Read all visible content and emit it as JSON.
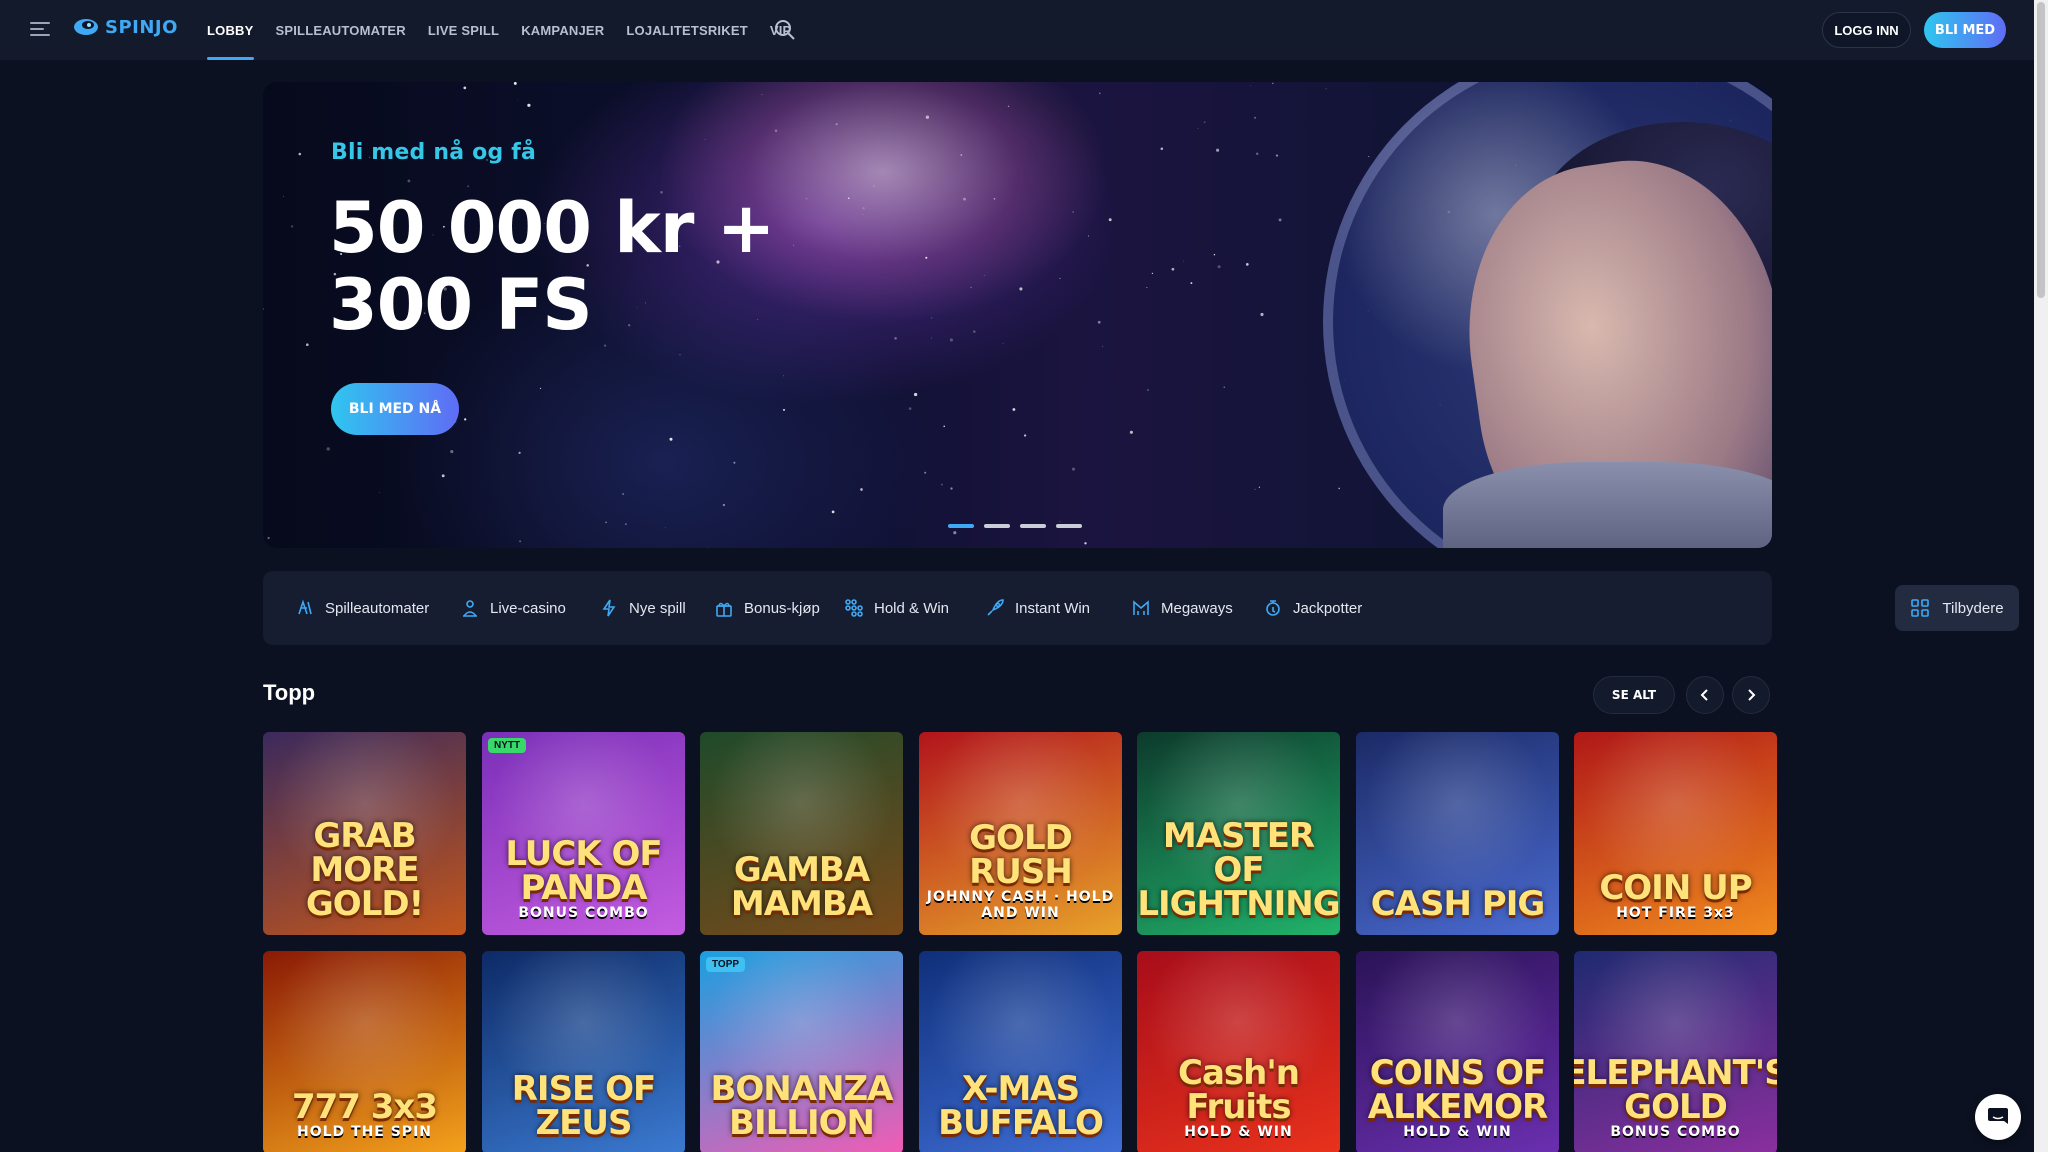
{
  "header": {
    "logo_text": "SPINJO",
    "nav": [
      {
        "label": "LOBBY",
        "active": true
      },
      {
        "label": "SPILLEAUTOMATER",
        "active": false
      },
      {
        "label": "LIVE SPILL",
        "active": false
      },
      {
        "label": "KAMPANJER",
        "active": false
      },
      {
        "label": "LOJALITETSRIKET",
        "active": false
      },
      {
        "label": "VIP",
        "active": false
      }
    ],
    "login_label": "LOGG INN",
    "join_label": "BLI MED"
  },
  "hero": {
    "eyebrow": "Bli med nå og få",
    "title_line1": "50 000 kr +",
    "title_line2": "300 FS",
    "cta_label": "BLI MED NÅ",
    "slides_total": 4,
    "active_slide": 1
  },
  "categories": [
    {
      "label": "Spilleautomater",
      "icon": "slot-machine-icon"
    },
    {
      "label": "Live-casino",
      "icon": "live-dealer-icon"
    },
    {
      "label": "Nye spill",
      "icon": "lightning-icon"
    },
    {
      "label": "Bonus-kjøp",
      "icon": "gift-icon"
    },
    {
      "label": "Hold & Win",
      "icon": "grid-dots-icon"
    },
    {
      "label": "Instant Win",
      "icon": "rocket-icon"
    },
    {
      "label": "Megaways",
      "icon": "megaways-icon"
    },
    {
      "label": "Jackpotter",
      "icon": "jackpot-icon"
    }
  ],
  "providers_label": "Tilbydere",
  "section": {
    "title": "Topp",
    "see_all_label": "SE ALT"
  },
  "games": [
    {
      "title": "GRAB MORE GOLD!",
      "subtitle": "",
      "badge": "",
      "bg1": "#3b2a5c",
      "bg2": "#c2561c"
    },
    {
      "title": "LUCK OF PANDA",
      "subtitle": "BONUS COMBO",
      "badge": "NYTT",
      "bg1": "#7a2fb8",
      "bg2": "#c45ce0"
    },
    {
      "title": "GAMBA MAMBA",
      "subtitle": "",
      "badge": "",
      "bg1": "#1f4a2a",
      "bg2": "#7a4a1a"
    },
    {
      "title": "GOLD RUSH",
      "subtitle": "JOHNNY CASH · HOLD AND WIN",
      "badge": "",
      "bg1": "#b2141c",
      "bg2": "#e8a22a"
    },
    {
      "title": "MASTER OF LIGHTNING",
      "subtitle": "",
      "badge": "",
      "bg1": "#0d3a2c",
      "bg2": "#21b36b"
    },
    {
      "title": "CASH PIG",
      "subtitle": "",
      "badge": "",
      "bg1": "#1b2a66",
      "bg2": "#4a6bd1"
    },
    {
      "title": "COIN UP",
      "subtitle": "HOT FIRE 3x3",
      "badge": "",
      "bg1": "#b01818",
      "bg2": "#f08a1e"
    },
    {
      "title": "777 3x3",
      "subtitle": "HOLD THE SPIN",
      "badge": "",
      "bg1": "#8a1a05",
      "bg2": "#f4a21c"
    },
    {
      "title": "RISE OF ZEUS",
      "subtitle": "",
      "badge": "",
      "bg1": "#0d2a66",
      "bg2": "#3b7ad1"
    },
    {
      "title": "BONANZA BILLION",
      "subtitle": "",
      "badge": "TOPP",
      "bg1": "#1aa0e0",
      "bg2": "#f25cb4"
    },
    {
      "title": "X-MAS BUFFALO",
      "subtitle": "",
      "badge": "",
      "bg1": "#0f2f7a",
      "bg2": "#3f6ed6"
    },
    {
      "title": "Cash'n Fruits",
      "subtitle": "HOLD & WIN",
      "badge": "",
      "bg1": "#a80d1a",
      "bg2": "#e8321c"
    },
    {
      "title": "COINS OF ALKEMOR",
      "subtitle": "HOLD & WIN",
      "badge": "",
      "bg1": "#2a1357",
      "bg2": "#6b2fb0"
    },
    {
      "title": "ELEPHANT'S GOLD",
      "subtitle": "BONUS COMBO",
      "badge": "",
      "bg1": "#1f2a70",
      "bg2": "#8a2f9e"
    }
  ],
  "colors": {
    "accent": "#3fa9f5",
    "accent_gradient_start": "#2fc6ef",
    "accent_gradient_end": "#5f6cf5",
    "background": "#0b1120",
    "badge_new": "#38d96a",
    "badge_top": "#3fc0f0"
  }
}
